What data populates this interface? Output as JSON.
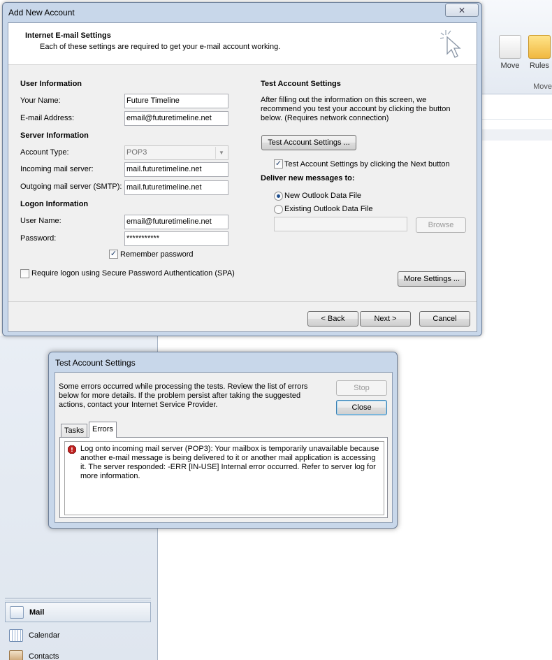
{
  "background": {
    "ribbon": {
      "move_label": "Move",
      "rules_label": "Rules",
      "group_label": "Move"
    },
    "nav": {
      "mail": "Mail",
      "calendar": "Calendar",
      "contacts": "Contacts"
    }
  },
  "dialog1": {
    "title": "Add New Account",
    "header_title": "Internet E-mail Settings",
    "header_subtitle": "Each of these settings are required to get your e-mail account working.",
    "user_info": {
      "section": "User Information",
      "name_label": "Your Name:",
      "name_value": "Future Timeline",
      "email_label": "E-mail Address:",
      "email_value": "email@futuretimeline.net"
    },
    "server_info": {
      "section": "Server Information",
      "account_type_label": "Account Type:",
      "account_type_value": "POP3",
      "incoming_label": "Incoming mail server:",
      "incoming_value": "mail.futuretimeline.net",
      "outgoing_label": "Outgoing mail server (SMTP):",
      "outgoing_value": "mail.futuretimeline.net"
    },
    "logon_info": {
      "section": "Logon Information",
      "username_label": "User Name:",
      "username_value": "email@futuretimeline.net",
      "password_label": "Password:",
      "password_value": "***********",
      "remember_label": "Remember password",
      "spa_label": "Require logon using Secure Password Authentication (SPA)"
    },
    "test": {
      "section": "Test Account Settings",
      "description": "After filling out the information on this screen, we recommend you test your account by clicking the button below. (Requires network connection)",
      "button": "Test Account Settings ...",
      "auto_test_label": "Test Account Settings by clicking the Next button",
      "deliver_section": "Deliver new messages to:",
      "new_file_label": "New Outlook Data File",
      "existing_file_label": "Existing Outlook Data File",
      "browse": "Browse",
      "more_settings": "More Settings ..."
    },
    "footer": {
      "back": "< Back",
      "next": "Next >",
      "cancel": "Cancel"
    }
  },
  "dialog2": {
    "title": "Test Account Settings",
    "message": "Some errors occurred while processing the tests. Review the list of errors below for more details. If the problem persist after taking the suggested actions, contact your Internet Service Provider.",
    "stop": "Stop",
    "close": "Close",
    "tabs": [
      "Tasks",
      "Errors"
    ],
    "error": "Log onto incoming mail server (POP3): Your mailbox is temporarily unavailable because another e-mail message is being delivered to it or another mail application is accessing it. The server responded: -ERR [IN-USE] Internal error occurred. Refer to server log for more information."
  },
  "colors": {
    "accent": "#1f4f8f",
    "frame": "#c8d7ea",
    "error": "#c0211f"
  }
}
